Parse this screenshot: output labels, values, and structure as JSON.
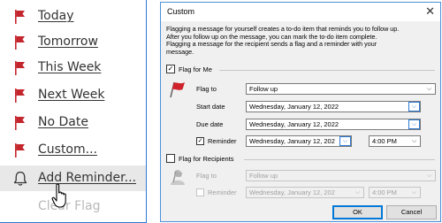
{
  "menu": {
    "items": [
      {
        "label": "Today",
        "underline": true
      },
      {
        "label": "Tomorrow",
        "underline": true
      },
      {
        "label": "This Week",
        "underline": true
      },
      {
        "label": "Next Week",
        "underline": true
      },
      {
        "label": "No Date",
        "underline": true
      },
      {
        "label": "Custom...",
        "underline": true
      },
      {
        "label": "Add Reminder...",
        "underline": true
      },
      {
        "label": "Clear Flag",
        "underline": false
      }
    ],
    "flag_color": "#c4262e",
    "hover_item": "Add Reminder..."
  },
  "dialog": {
    "title": "Custom",
    "close_glyph": "✕",
    "description": [
      "Flagging a message for yourself creates a to-do item that reminds you to follow up.",
      "After you follow up on the message, you can mark the to-do item complete.",
      "Flagging a message for the recipient sends a flag and a reminder with your",
      "message."
    ],
    "flag_for_me": {
      "label": "Flag for Me",
      "checked": true,
      "flag_to_label": "Flag to",
      "flag_to_value": "Follow up",
      "start_date_label": "Start date",
      "start_date_value": "Wednesday, January 12, 2022",
      "due_date_label": "Due date",
      "due_date_value": "Wednesday, January 12, 2022",
      "reminder_label": "Reminder",
      "reminder_checked": true,
      "reminder_date_value": "Wednesday, January 12, 202",
      "reminder_time_value": "4:00 PM"
    },
    "flag_for_recipients": {
      "label": "Flag for Recipients",
      "checked": false,
      "flag_to_label": "Flag to",
      "flag_to_value": "Follow up",
      "reminder_label": "Reminder",
      "reminder_checked": false,
      "reminder_date_value": "Wednesday, January 12, 202",
      "reminder_time_value": "4:00 PM"
    },
    "ok_label": "OK",
    "cancel_label": "Cancel",
    "check_glyph": "✓",
    "dropdown_glyph": "⌵"
  }
}
